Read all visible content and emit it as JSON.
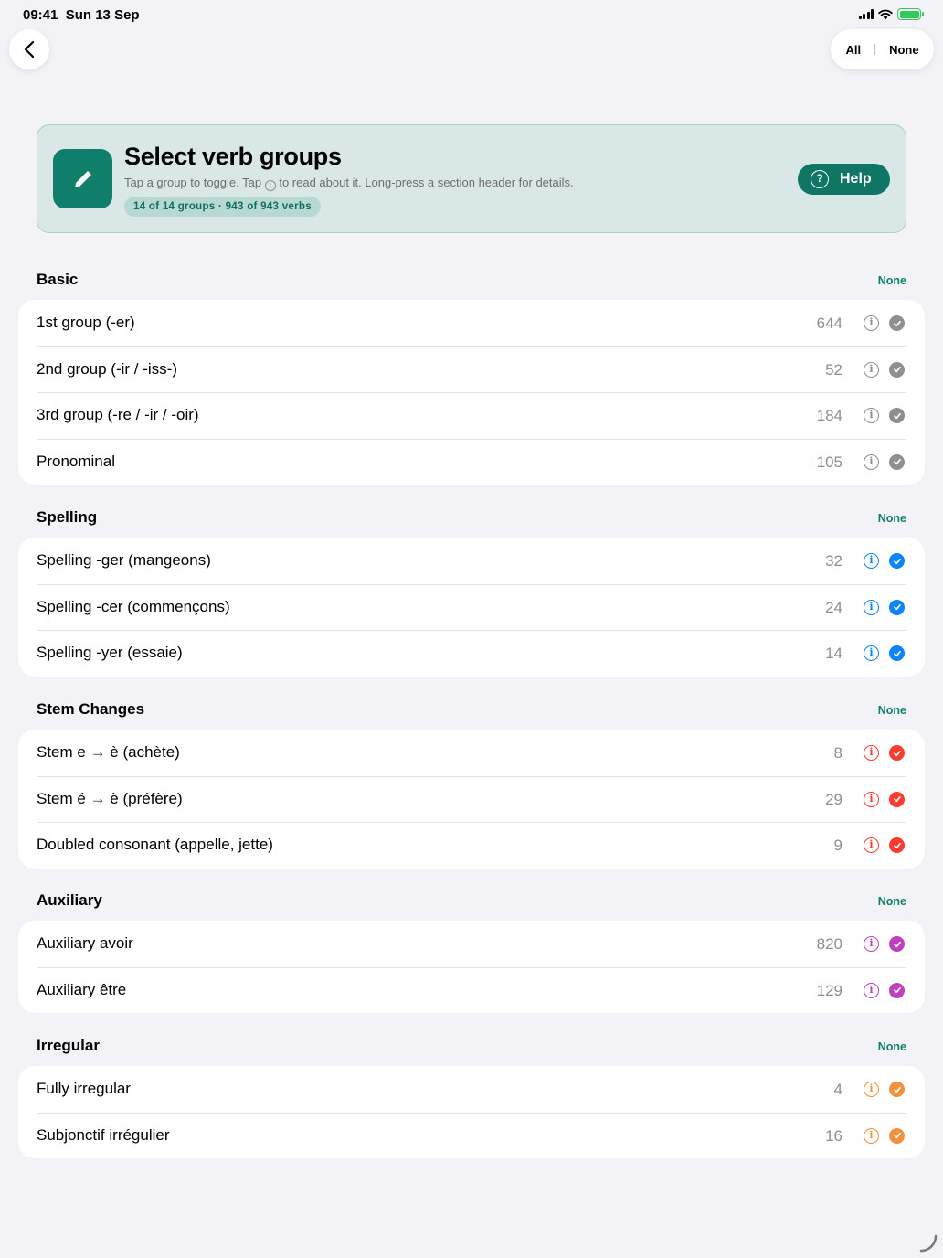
{
  "status": {
    "time": "09:41",
    "date": "Sun 13 Sep"
  },
  "nav": {
    "all_label": "All",
    "none_label": "None"
  },
  "hero": {
    "title": "Select verb groups",
    "subtitle_pre": "Tap a group to toggle. Tap ",
    "subtitle_info_glyph": "i",
    "subtitle_post": " to read about it. Long-press a section header for details.",
    "badge": "14 of 14 groups · 943 of 943 verbs",
    "help_label": "Help",
    "help_glyph": "?"
  },
  "colors": {
    "accent": "#0f7f6c",
    "basic": "#8e8e93",
    "spelling": "#0a84ff",
    "stem": "#ff3b30",
    "auxiliary": "#bf40bf",
    "irregular": "#f2913d"
  },
  "sections": [
    {
      "title": "Basic",
      "none_label": "None",
      "color": "#8e8e93",
      "items": [
        {
          "label": "1st group (-er)",
          "count": "644"
        },
        {
          "label": "2nd group (-ir / -iss-)",
          "count": "52"
        },
        {
          "label": "3rd group (-re / -ir / -oir)",
          "count": "184"
        },
        {
          "label": "Pronominal",
          "count": "105"
        }
      ]
    },
    {
      "title": "Spelling",
      "none_label": "None",
      "color": "#0a84ff",
      "items": [
        {
          "label": "Spelling -ger (mangeons)",
          "count": "32"
        },
        {
          "label": "Spelling -cer (commençons)",
          "count": "24"
        },
        {
          "label": "Spelling -yer (essaie)",
          "count": "14"
        }
      ]
    },
    {
      "title": "Stem Changes",
      "none_label": "None",
      "color": "#ff3b30",
      "items": [
        {
          "label": "Stem e → è (achète)",
          "count": "8"
        },
        {
          "label": "Stem é → è (préfère)",
          "count": "29"
        },
        {
          "label": "Doubled consonant (appelle, jette)",
          "count": "9"
        }
      ]
    },
    {
      "title": "Auxiliary",
      "none_label": "None",
      "color": "#bf40bf",
      "items": [
        {
          "label": "Auxiliary avoir",
          "count": "820"
        },
        {
          "label": "Auxiliary être",
          "count": "129"
        }
      ]
    },
    {
      "title": "Irregular",
      "none_label": "None",
      "color": "#f2913d",
      "items": [
        {
          "label": "Fully irregular",
          "count": "4"
        },
        {
          "label": "Subjonctif irrégulier",
          "count": "16"
        }
      ]
    }
  ]
}
